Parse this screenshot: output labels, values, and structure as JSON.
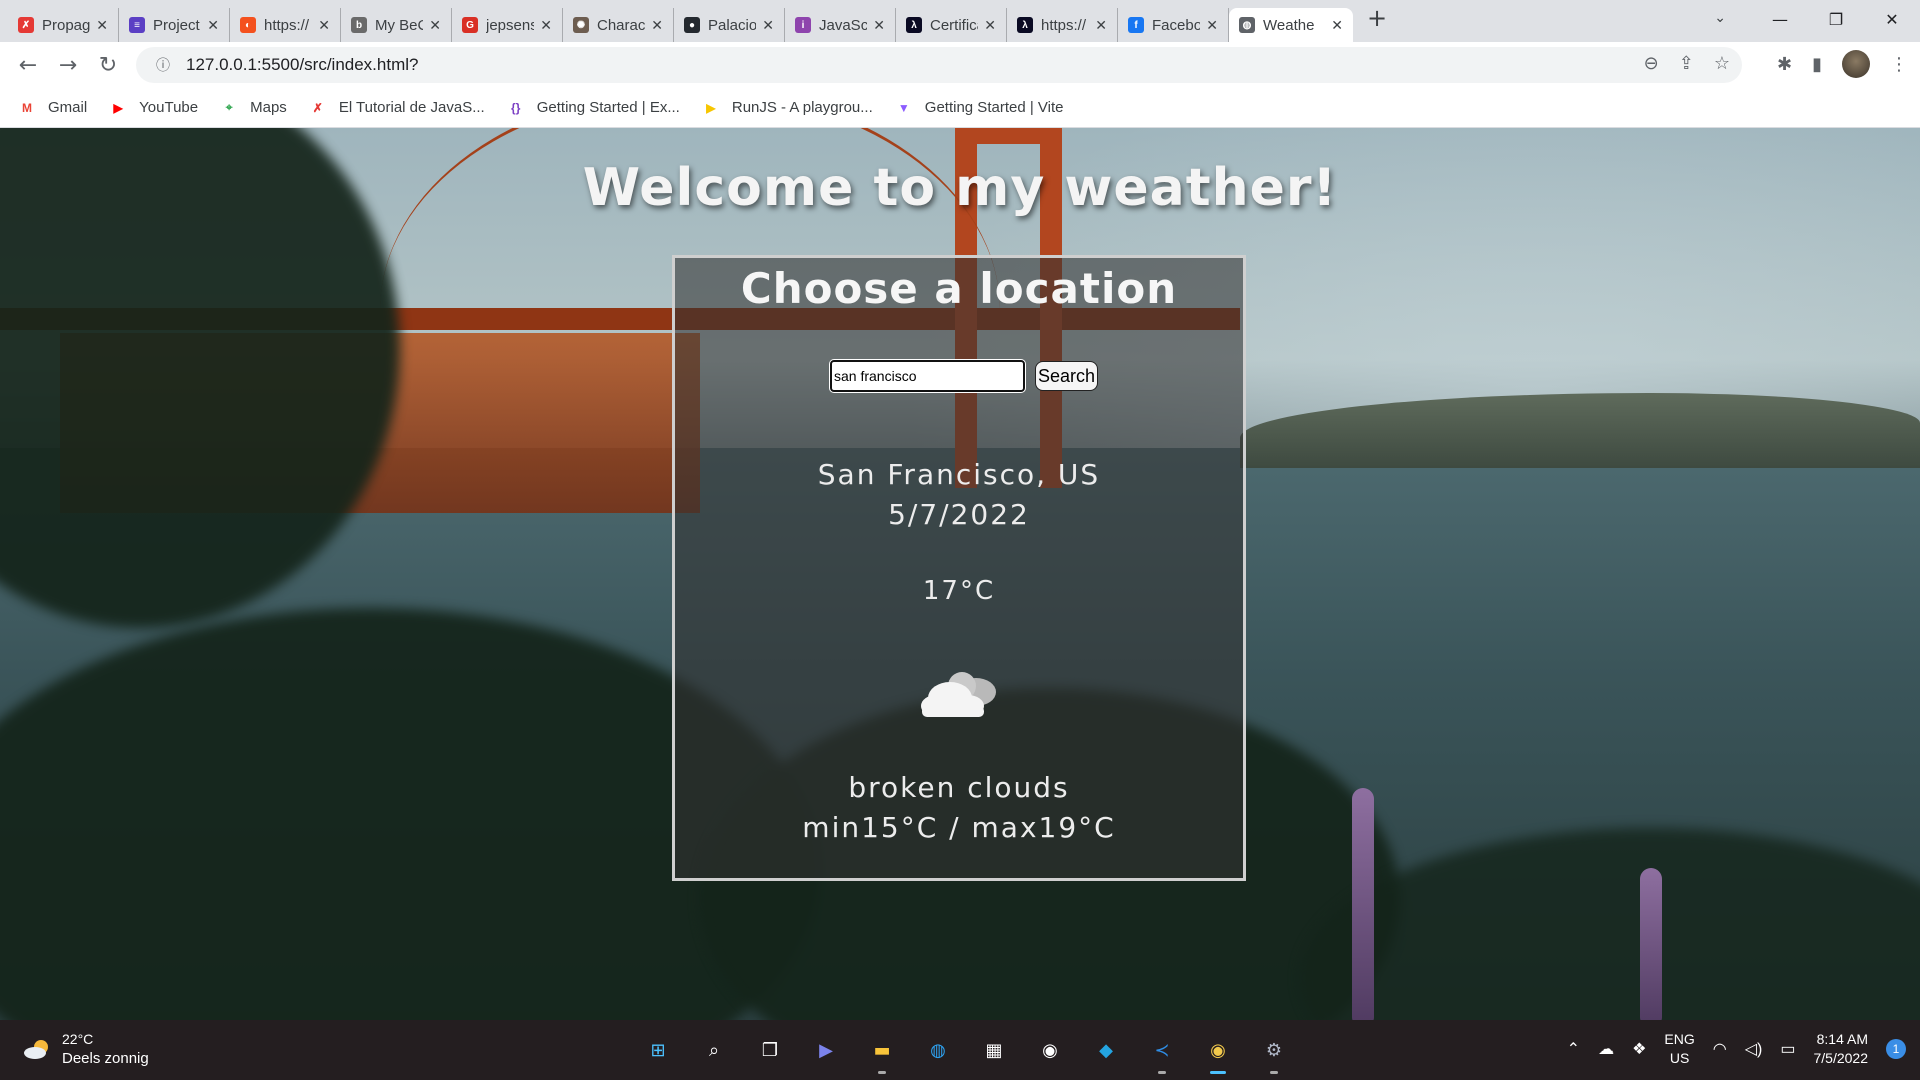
{
  "browser": {
    "tabs": [
      {
        "title": "Propag",
        "favicon_color": "#e53935",
        "favicon_glyph": "✗"
      },
      {
        "title": "Project",
        "favicon_color": "#5b3fc4",
        "favicon_glyph": "≡"
      },
      {
        "title": "https://",
        "favicon_color": "#f4511e",
        "favicon_glyph": "◐"
      },
      {
        "title": "My BeC",
        "favicon_color": "#6a6a6a",
        "favicon_glyph": "b"
      },
      {
        "title": "jepsens",
        "favicon_color": "#d93025",
        "favicon_glyph": "G"
      },
      {
        "title": "Charact",
        "favicon_color": "#6d5d50",
        "favicon_glyph": "✺"
      },
      {
        "title": "Palacio",
        "favicon_color": "#24292f",
        "favicon_glyph": "●"
      },
      {
        "title": "JavaScri",
        "favicon_color": "#8e44ad",
        "favicon_glyph": "i"
      },
      {
        "title": "Certifica",
        "favicon_color": "#0a0a23",
        "favicon_glyph": "λ"
      },
      {
        "title": "https://",
        "favicon_color": "#0a0a23",
        "favicon_glyph": "λ"
      },
      {
        "title": "Facebo",
        "favicon_color": "#1877f2",
        "favicon_glyph": "f"
      },
      {
        "title": "Weathe",
        "favicon_color": "#5f6368",
        "favicon_glyph": "◍",
        "active": true
      }
    ],
    "new_tab_glyph": "+",
    "tab_search_glyph": "⌄",
    "window_controls": {
      "minimize": "—",
      "restore": "❐",
      "close": "✕"
    },
    "nav": {
      "back": "←",
      "forward": "→",
      "reload": "↻"
    },
    "address_info_glyph": "ⓘ",
    "url": "127.0.0.1:5500/src/index.html?",
    "omnibox_icons": {
      "zoom": "⊖",
      "share": "⇪",
      "bookmark": "☆"
    },
    "toolbar_icons": {
      "extensions": "✱",
      "sidepanel": "▮",
      "menu": "⋮"
    },
    "bookmarks": [
      {
        "label": "Gmail",
        "icon_color": "#ea4335",
        "glyph": "M"
      },
      {
        "label": "YouTube",
        "icon_color": "#ff0000",
        "glyph": "▶"
      },
      {
        "label": "Maps",
        "icon_color": "#34a853",
        "glyph": "⌖"
      },
      {
        "label": "El Tutorial de JavaS...",
        "icon_color": "#e53935",
        "glyph": "✗"
      },
      {
        "label": "Getting Started | Ex...",
        "icon_color": "#7b3fc4",
        "glyph": "{}"
      },
      {
        "label": "RunJS - A playgrou...",
        "icon_color": "#f7c600",
        "glyph": "▶"
      },
      {
        "label": "Getting Started | Vite",
        "icon_color": "#8c5cff",
        "glyph": "▼"
      }
    ]
  },
  "page": {
    "heading": "Welcome to my weather!",
    "card": {
      "title": "Choose a location",
      "search_value": "san francisco",
      "search_button": "Search",
      "city": "San Francisco, US",
      "date": "5/7/2022",
      "temperature": "17°C",
      "icon": "broken-clouds-icon",
      "description": "broken clouds",
      "min_max": "min15°C / max19°C"
    }
  },
  "taskbar": {
    "weather_temp": "22°C",
    "weather_desc": "Deels zonnig",
    "apps": [
      {
        "name": "start",
        "glyph": "⊞",
        "color": "#4cc2ff"
      },
      {
        "name": "search",
        "glyph": "⌕",
        "color": "#ffffff"
      },
      {
        "name": "task-view",
        "glyph": "❐",
        "color": "#ffffff"
      },
      {
        "name": "teams-chat",
        "glyph": "▶",
        "color": "#7b83eb"
      },
      {
        "name": "file-explorer",
        "glyph": "▬",
        "color": "#f8c43a"
      },
      {
        "name": "edge",
        "glyph": "◍",
        "color": "#2ea3f2"
      },
      {
        "name": "store",
        "glyph": "▦",
        "color": "#ffffff"
      },
      {
        "name": "github",
        "glyph": "◉",
        "color": "#ffffff"
      },
      {
        "name": "vscode-insiders",
        "glyph": "◆",
        "color": "#24a4e0"
      },
      {
        "name": "vscode",
        "glyph": "≺",
        "color": "#2f8de4"
      },
      {
        "name": "chrome",
        "glyph": "◉",
        "color": "#f2c94c"
      },
      {
        "name": "settings",
        "glyph": "⚙",
        "color": "#b0b8c8"
      }
    ],
    "tray_chevron": "⌃",
    "language": "ENG",
    "region": "US",
    "time": "8:14 AM",
    "date": "7/5/2022",
    "notifications": "1"
  }
}
